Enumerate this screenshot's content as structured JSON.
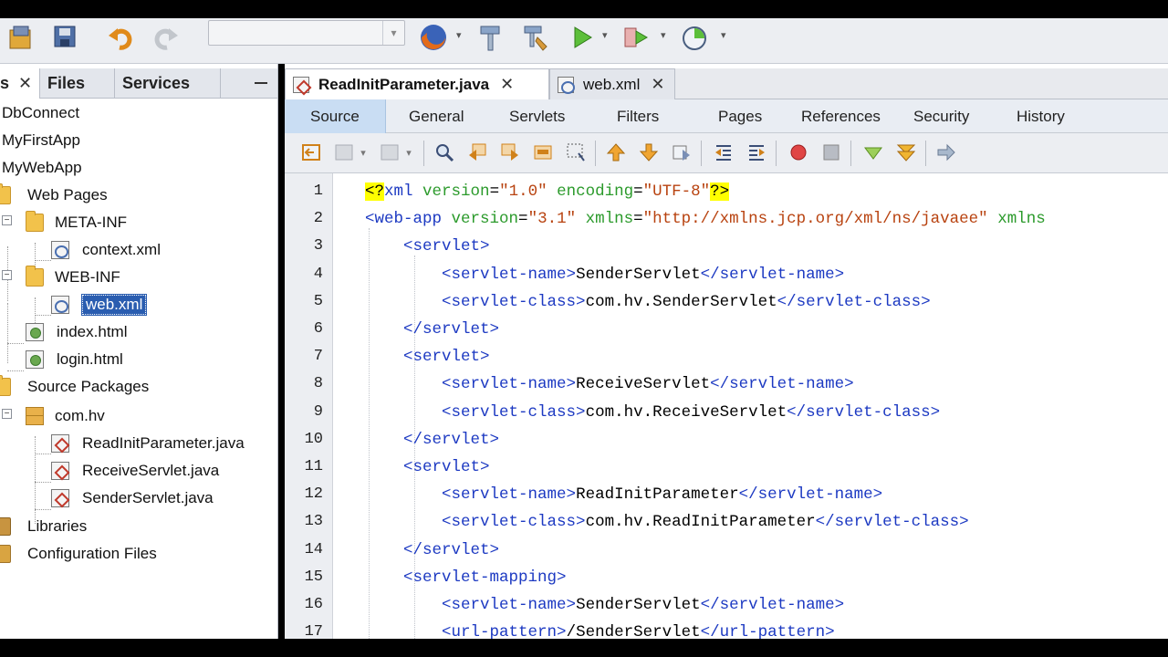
{
  "left_panel": {
    "tabs": [
      {
        "label": "s",
        "closable": true
      },
      {
        "label": "Files"
      },
      {
        "label": "Services"
      }
    ],
    "tree": [
      {
        "label": "DbConnect",
        "icon": "project-icon"
      },
      {
        "label": "MyFirstApp",
        "icon": "project-icon"
      },
      {
        "label": "MyWebApp",
        "icon": "project-icon"
      },
      {
        "label": "Web Pages",
        "icon": "folder-icon"
      },
      {
        "label": "META-INF",
        "icon": "folder-icon"
      },
      {
        "label": "context.xml",
        "icon": "xml-file-icon"
      },
      {
        "label": "WEB-INF",
        "icon": "folder-icon"
      },
      {
        "label": "web.xml",
        "icon": "xml-file-icon",
        "selected": true
      },
      {
        "label": "index.html",
        "icon": "html-file-icon"
      },
      {
        "label": "login.html",
        "icon": "html-file-icon"
      },
      {
        "label": "Source Packages",
        "icon": "folder-icon"
      },
      {
        "label": "com.hv",
        "icon": "package-icon"
      },
      {
        "label": "ReadInitParameter.java",
        "icon": "java-file-icon"
      },
      {
        "label": "ReceiveServlet.java",
        "icon": "java-file-icon"
      },
      {
        "label": "SenderServlet.java",
        "icon": "java-file-icon"
      },
      {
        "label": "Libraries",
        "icon": "libraries-icon"
      },
      {
        "label": "Configuration Files",
        "icon": "config-files-icon"
      }
    ]
  },
  "editor": {
    "file_tabs": [
      {
        "label": "ReadInitParameter.java",
        "active": true
      },
      {
        "label": "web.xml",
        "active": false
      }
    ],
    "view_tabs": [
      "Source",
      "General",
      "Servlets",
      "Filters",
      "Pages",
      "References",
      "Security",
      "History"
    ],
    "active_view": "Source",
    "line_numbers": [
      "1",
      "2",
      "3",
      "4",
      "5",
      "6",
      "7",
      "8",
      "9",
      "10",
      "11",
      "12",
      "13",
      "14",
      "15",
      "16",
      "17"
    ],
    "code_lines": [
      "<?xml version=\"1.0\" encoding=\"UTF-8\"?>",
      "<web-app version=\"3.1\" xmlns=\"http://xmlns.jcp.org/xml/ns/javaee\" xmlns",
      "    <servlet>",
      "        <servlet-name>SenderServlet</servlet-name>",
      "        <servlet-class>com.hv.SenderServlet</servlet-class>",
      "    </servlet>",
      "    <servlet>",
      "        <servlet-name>ReceiveServlet</servlet-name>",
      "        <servlet-class>com.hv.ReceiveServlet</servlet-class>",
      "    </servlet>",
      "    <servlet>",
      "        <servlet-name>ReadInitParameter</servlet-name>",
      "        <servlet-class>com.hv.ReadInitParameter</servlet-class>",
      "    </servlet>",
      "    <servlet-mapping>",
      "        <servlet-name>SenderServlet</servlet-name>",
      "        <url-pattern>/SenderServlet</url-pattern>"
    ]
  },
  "colors": {
    "tag": "#1c39c2",
    "attribute": "#2b9a2b",
    "value": "#b8420f",
    "selection": "#2a5db0"
  }
}
